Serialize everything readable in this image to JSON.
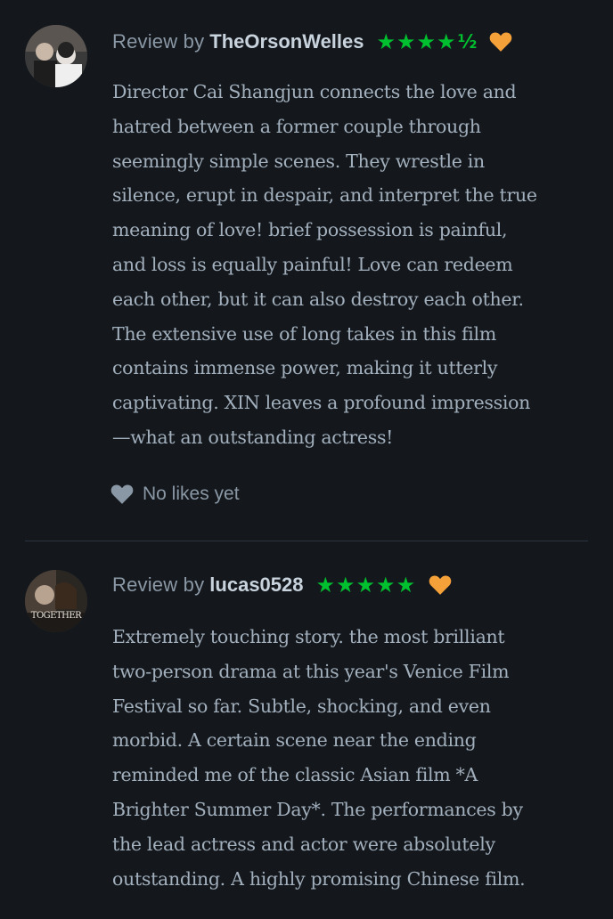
{
  "reviews": [
    {
      "review_by_label": "Review by",
      "username": "TheOrsonWelles",
      "rating_stars": "★★★★",
      "rating_half": "½",
      "rating": 4.5,
      "liked": true,
      "avatar_icon": "user-avatar-couple-photo",
      "text": "Director Cai Shangjun connects the love and\nhatred between a former couple through\nseemingly simple scenes. They wrestle in\nsilence, erupt in despair, and interpret the true\nmeaning of love!  brief possession is painful,\nand loss is equally painful!  Love can redeem\neach other, but it can also destroy each other.\nThe extensive use of long takes in this film\ncontains immense power, making it utterly\ncaptivating. XIN leaves a profound impression\n—what an outstanding actress!",
      "likes_label": "No likes yet"
    },
    {
      "review_by_label": "Review by",
      "username": "lucas0528",
      "rating_stars": "★★★★★",
      "rating": 5,
      "liked": true,
      "avatar_icon": "user-avatar-together-poster",
      "avatar_caption": "TOGETHER",
      "text": "Extremely touching story. the most brilliant\ntwo-person drama at this year's Venice Film\nFestival so far. Subtle, shocking, and even\nmorbid. A certain scene near the ending\nreminded me of the classic Asian film *A\nBrighter Summer Day*. The performances by\nthe lead actress and actor were absolutely\noutstanding. A highly promising Chinese film."
    }
  ],
  "colors": {
    "background": "#14181c",
    "star_green": "#00c030",
    "heart_orange": "#f5a13a",
    "text": "#a2afbd",
    "username": "#c8d3dd"
  }
}
